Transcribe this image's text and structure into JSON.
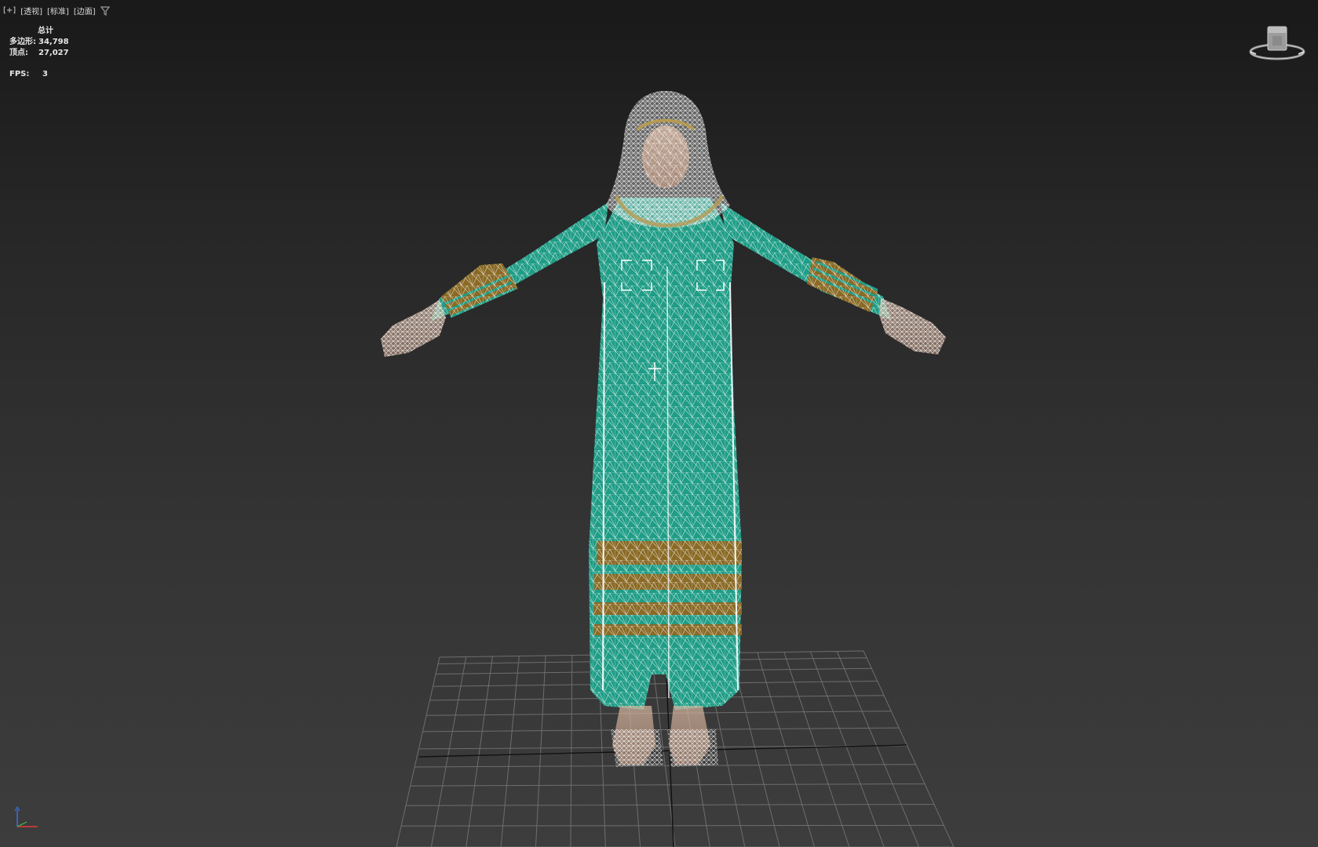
{
  "viewport": {
    "labels": [
      "[+]",
      "[透视]",
      "[标准]",
      "[边面]"
    ],
    "filter_icon": "filter-funnel-icon"
  },
  "stats": {
    "header": "总计",
    "polys_label": "多边形:",
    "polys_value": "34,798",
    "verts_label": "顶点:",
    "verts_value": "27,027",
    "fps_label": "FPS:",
    "fps_value": "3"
  },
  "viewcube": {
    "icon": "viewcube-home-icon"
  },
  "colors": {
    "dress": "#1f9d86",
    "band": "#8a6a25",
    "wire": "#ffffff",
    "grid": "#6a6a6a"
  }
}
